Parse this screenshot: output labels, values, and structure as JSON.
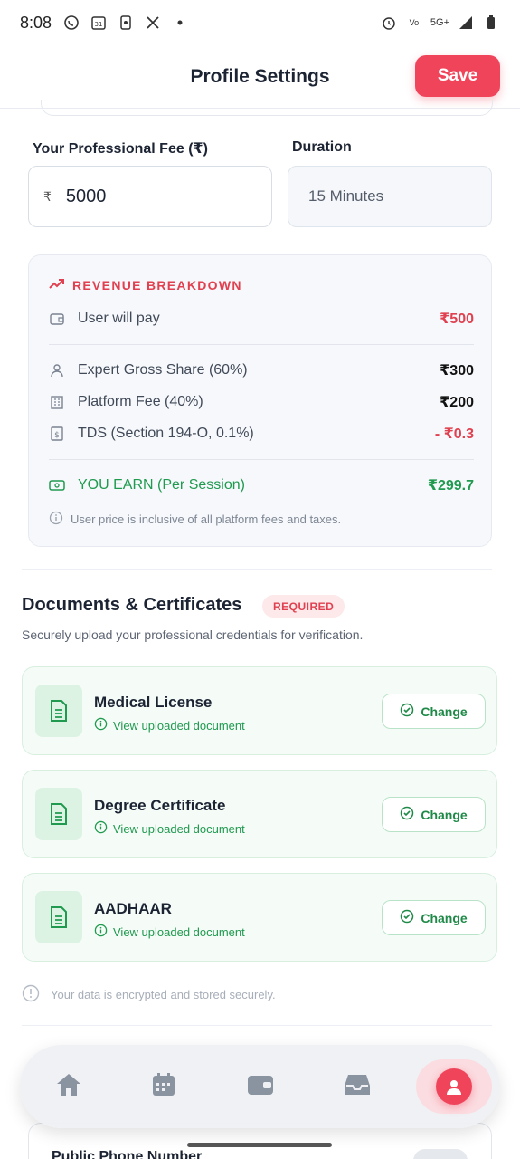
{
  "status_bar": {
    "time": "8:08",
    "right_text": "5G+"
  },
  "header": {
    "title": "Profile Settings",
    "save_label": "Save"
  },
  "fee": {
    "label": "Your Professional Fee (₹)",
    "currency_symbol": "₹",
    "value": "5000"
  },
  "duration": {
    "label": "Duration",
    "value": "15 Minutes"
  },
  "revenue": {
    "title": "REVENUE BREAKDOWN",
    "user_pays_label": "User will pay",
    "user_pays_value": "₹500",
    "expert_share_label": "Expert Gross Share (60%)",
    "expert_share_value": "₹300",
    "platform_fee_label": "Platform Fee (40%)",
    "platform_fee_value": "₹200",
    "tds_label": "TDS (Section 194-O, 0.1%)",
    "tds_value": "- ₹0.3",
    "earn_label": "YOU EARN (Per Session)",
    "earn_value": "₹299.7",
    "note": "User price is inclusive of all platform fees and taxes."
  },
  "documents": {
    "title": "Documents & Certificates",
    "badge": "REQUIRED",
    "subtitle": "Securely upload your professional credentials for verification.",
    "items": [
      {
        "name": "Medical License",
        "link": "View uploaded document",
        "action": "Change"
      },
      {
        "name": "Degree Certificate",
        "link": "View uploaded document",
        "action": "Change"
      },
      {
        "name": "AADHAAR",
        "link": "View uploaded document",
        "action": "Change"
      }
    ],
    "secure_note": "Your data is encrypted and stored securely."
  },
  "contact": {
    "phone_label": "Public Phone Number"
  },
  "colors": {
    "accent": "#f0445a",
    "success": "#1f9a4f",
    "danger": "#e0404f"
  }
}
